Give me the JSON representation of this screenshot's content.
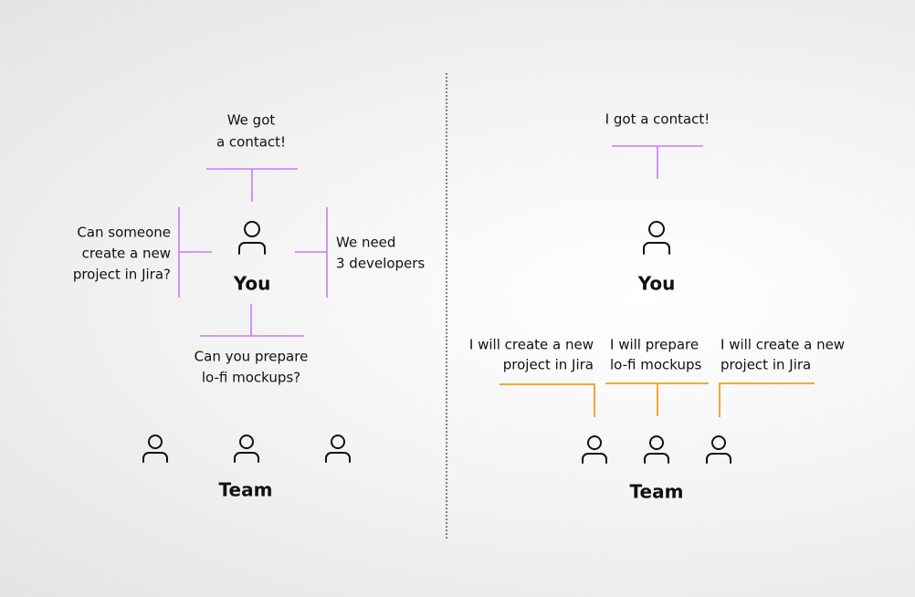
{
  "colors": {
    "before_lines": "#c97bff",
    "after_lines": "#ff9a1a",
    "text": "#111111"
  },
  "left": {
    "top_message": [
      "We got",
      "a contact!"
    ],
    "left_message": [
      "Can someone",
      "create a new",
      "project in Jira?"
    ],
    "right_message": [
      "We need",
      "3 developers"
    ],
    "bottom_message": [
      "Can you prepare",
      "lo-fi mockups?"
    ],
    "you_label": "You",
    "team_label": "Team"
  },
  "right": {
    "top_message": "I got a contact!",
    "you_label": "You",
    "team_messages": [
      [
        "I will create a new",
        "project in Jira"
      ],
      [
        "I will prepare",
        "lo-fi mockups"
      ],
      [
        "I will create a new",
        "project in Jira"
      ]
    ],
    "team_label": "Team"
  },
  "icons": {
    "person": "person-icon"
  }
}
